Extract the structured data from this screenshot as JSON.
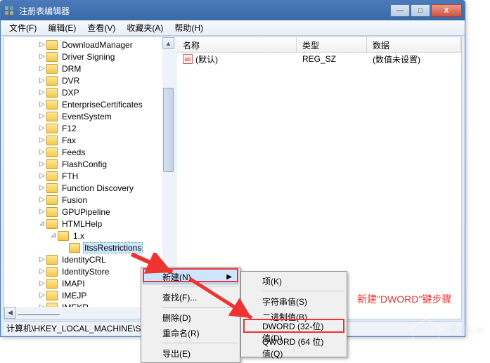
{
  "window": {
    "title": "注册表编辑器",
    "minimize": "—",
    "maximize": "□",
    "close": "X"
  },
  "menu": {
    "file": "文件(F)",
    "edit": "编辑(E)",
    "view": "查看(V)",
    "favorites": "收藏夹(A)",
    "help": "帮助(H)"
  },
  "columns": {
    "name": "名称",
    "type": "类型",
    "data": "数据"
  },
  "values": [
    {
      "icon": "ab",
      "name": "(默认)",
      "type": "REG_SZ",
      "data": "(数值未设置)"
    }
  ],
  "tree": [
    {
      "d": 3,
      "exp": "▷",
      "label": "DownloadManager"
    },
    {
      "d": 3,
      "exp": "▷",
      "label": "Driver Signing"
    },
    {
      "d": 3,
      "exp": "▷",
      "label": "DRM"
    },
    {
      "d": 3,
      "exp": "▷",
      "label": "DVR"
    },
    {
      "d": 3,
      "exp": "▷",
      "label": "DXP"
    },
    {
      "d": 3,
      "exp": "▷",
      "label": "EnterpriseCertificates"
    },
    {
      "d": 3,
      "exp": "▷",
      "label": "EventSystem"
    },
    {
      "d": 3,
      "exp": "▷",
      "label": "F12"
    },
    {
      "d": 3,
      "exp": "▷",
      "label": "Fax"
    },
    {
      "d": 3,
      "exp": "▷",
      "label": "Feeds"
    },
    {
      "d": 3,
      "exp": "▷",
      "label": "FlashConfig"
    },
    {
      "d": 3,
      "exp": "▷",
      "label": "FTH"
    },
    {
      "d": 3,
      "exp": "▷",
      "label": "Function Discovery"
    },
    {
      "d": 3,
      "exp": "▷",
      "label": "Fusion"
    },
    {
      "d": 3,
      "exp": "▷",
      "label": "GPUPipeline"
    },
    {
      "d": 3,
      "exp": "⊿",
      "label": "HTMLHelp"
    },
    {
      "d": 4,
      "exp": "⊿",
      "label": "1.x"
    },
    {
      "d": 5,
      "exp": "",
      "label": "ItssRestrictions",
      "sel": true
    },
    {
      "d": 3,
      "exp": "▷",
      "label": "IdentityCRL"
    },
    {
      "d": 3,
      "exp": "▷",
      "label": "IdentityStore"
    },
    {
      "d": 3,
      "exp": "▷",
      "label": "IMAPI"
    },
    {
      "d": 3,
      "exp": "▷",
      "label": "IMEJP"
    },
    {
      "d": 3,
      "exp": "▷",
      "label": "IMEKR"
    }
  ],
  "status": "计算机\\HKEY_LOCAL_MACHINE\\S",
  "context1": {
    "new": "新建(N)",
    "find": "查找(F)...",
    "delete": "删除(D)",
    "rename": "重命名(R)",
    "export": "导出(E)"
  },
  "context2": {
    "key": "项(K)",
    "string": "字符串值(S)",
    "binary": "二进制值(B)",
    "dword": "DWORD (32-位)值(D)",
    "qword": "QWORD (64 位)值(Q)"
  },
  "annotation": "新建\"DWORD\"键步骤",
  "watermark": "系统之家"
}
